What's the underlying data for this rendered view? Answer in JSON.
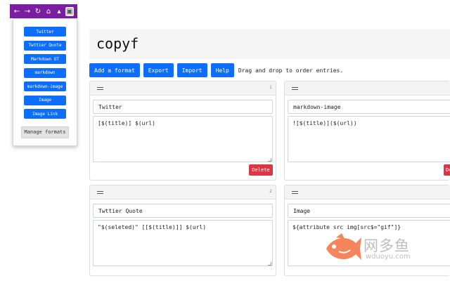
{
  "browser": {
    "back_icon": "arrow-left-icon",
    "forward_icon": "arrow-right-icon",
    "reload_icon": "reload-icon",
    "home_icon": "home-icon",
    "extension_icon": "extension-puzzle-icon",
    "active_extension_icon": "copyf-extension-icon",
    "toolbar_color": "#7b1fa2"
  },
  "popup": {
    "formats": [
      "Twitter",
      "Twttier Quote",
      "Markdown OT",
      "markdown",
      "markdown-image",
      "Image",
      "Image Link"
    ],
    "manage_label": "Manage formats"
  },
  "page": {
    "title": "copyf"
  },
  "toolbar": {
    "add_label": "Add a format",
    "export_label": "Export",
    "import_label": "Import",
    "help_label": "Help",
    "hint": "Drag and drop to order entries."
  },
  "cards": [
    {
      "number": "1",
      "name": "Twitter",
      "format": "[$(title)] $(url)",
      "delete_label": "Delete"
    },
    {
      "number": "",
      "name": "markdown-image",
      "format": "![$(title)]($(url))",
      "delete_label": "De"
    },
    {
      "number": "2",
      "name": "Twttier Quote",
      "format": "\"$(seleted)\" [[$(title)]] $(url)"
    },
    {
      "number": "",
      "name": "Image",
      "format": "${attribute src img[src$=\"gif\"]}"
    }
  ],
  "watermark": {
    "cn": "网多鱼",
    "url": "wduoyu.com"
  },
  "colors": {
    "primary": "#0d6efd",
    "danger": "#dc3545",
    "header_bg": "#f5f5f5"
  }
}
